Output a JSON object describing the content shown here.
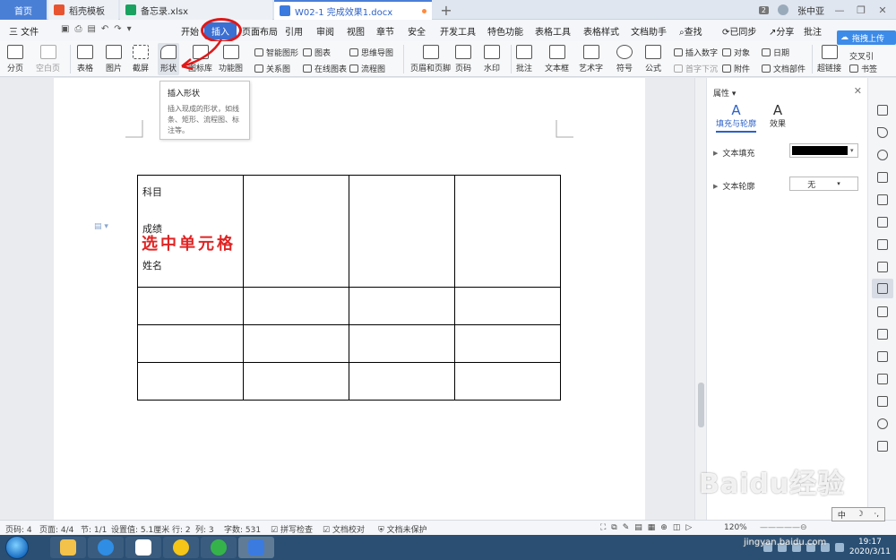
{
  "tabs": {
    "home": "首页",
    "template": "稻壳模板",
    "xlsx": "备忘录.xlsx",
    "doc": "W02-1 完成效果1.docx",
    "new": "+"
  },
  "titlebar": {
    "count_badge": "2",
    "user": "张中亚"
  },
  "menu": {
    "file": "三 文件",
    "start": "开始",
    "insert": "插入",
    "layout": "页面布局",
    "reference": "引用",
    "review": "审阅",
    "view": "视图",
    "chapter": "章节",
    "security": "安全",
    "dev": "开发工具",
    "special": "特色功能",
    "table_tools": "表格工具",
    "table_style": "表格样式",
    "doc_helper": "文档助手",
    "search": "查找",
    "sync": "已同步",
    "share": "分享",
    "comment": "批注"
  },
  "ribbon": {
    "page_break": "分页",
    "blank_page": "空白页",
    "table": "表格",
    "picture": "图片",
    "screenshot": "截屏",
    "shape": "形状",
    "icon_lib": "图标库",
    "func_chart": "功能图",
    "smart_art": "智能图形",
    "chart": "图表",
    "mindmap": "思维导图",
    "relation": "关系图",
    "online_chart": "在线图表",
    "flowchart": "流程图",
    "header_footer": "页眉和页脚",
    "page_num": "页码",
    "watermark": "水印",
    "comment_btn": "批注",
    "textbox": "文本框",
    "wordart": "艺术字",
    "symbol": "符号",
    "formula": "公式",
    "insert_num": "插入数字",
    "object": "对象",
    "date": "日期",
    "first_drop": "首字下沉",
    "attachment": "附件",
    "doc_part": "文档部件",
    "hyperlink": "超链接",
    "cross_ref": "交叉引",
    "bookmark": "书签",
    "upload": "拖拽上传"
  },
  "tooltip": {
    "title": "插入形状",
    "body": "插入现成的形状，如线条、矩形、流程图、标注等。"
  },
  "table": {
    "cell_subject": "科目",
    "cell_score": "成绩",
    "cell_name": "姓名",
    "handwriting": "选中单元格"
  },
  "properties": {
    "header": "属性",
    "tab_fill": "填充与轮廓",
    "tab_effect": "效果",
    "text_fill": "文本填充",
    "text_outline": "文本轮廓",
    "outline_value": "无",
    "fill_color": "#000000"
  },
  "status": {
    "page_no": "页码: 4",
    "pages": "页面: 4/4",
    "section": "节: 1/1",
    "setting": "设置值: 5.1厘米",
    "row": "行: 2",
    "col": "列: 3",
    "words": "字数: 531",
    "spell": "拼写检查",
    "proof": "文档校对",
    "protect": "文档未保护",
    "zoom": "120%"
  },
  "taskbar": {
    "time": "19:17",
    "date": "2020/3/11"
  },
  "watermark": {
    "brand": "Baidu经验",
    "url": "jingyan.baidu.com"
  },
  "ime": {
    "lang": "中",
    "moon": "☽",
    "punct": "·,"
  },
  "colors": {
    "accent": "#3b6fd1",
    "annotation_red": "#e02424"
  }
}
